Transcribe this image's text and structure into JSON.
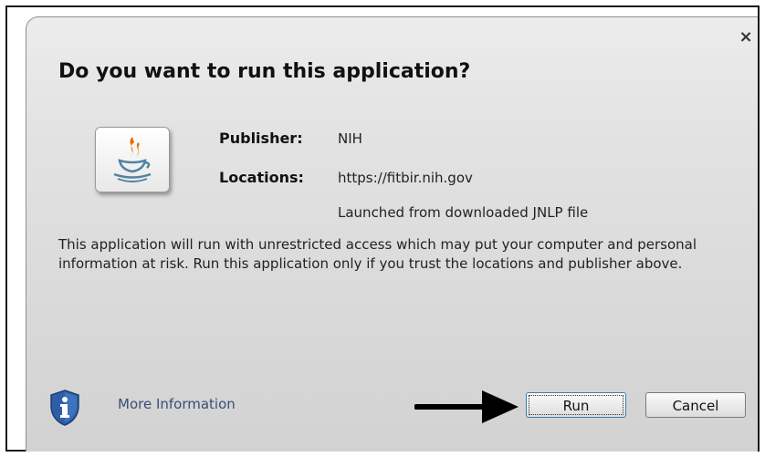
{
  "dialog": {
    "title": "Do you want to run this application?",
    "close_glyph": "×",
    "app_icon": "java-icon",
    "publisher_label": "Publisher:",
    "publisher_value": "NIH",
    "locations_label": "Locations:",
    "locations_value": "https://fitbir.nih.gov",
    "launch_note": "Launched from downloaded JNLP file",
    "warning_text": "This application will run with unrestricted access which may put your computer and personal information at risk. Run this application only if you trust the locations and publisher above.",
    "info_icon": "shield-info-icon",
    "more_info_label": "More Information",
    "run_label": "Run",
    "cancel_label": "Cancel"
  },
  "colors": {
    "link": "#3a4f78",
    "shield": "#2e5fa6",
    "java_steam": "#e76f00",
    "java_cup": "#5382a1"
  }
}
